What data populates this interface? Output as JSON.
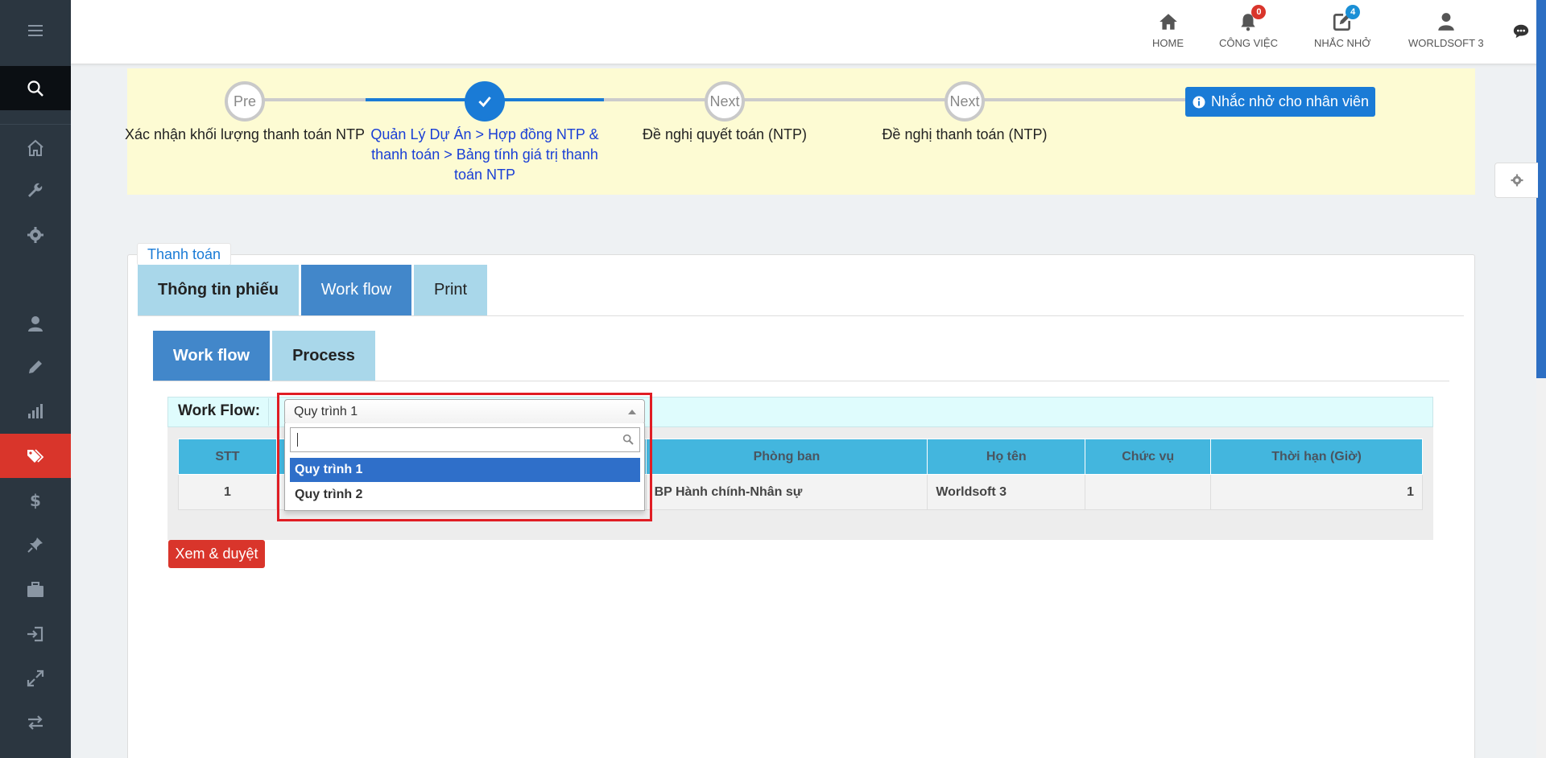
{
  "topbar": {
    "home_label": "HOME",
    "tasks_label": "CÔNG VIỆC",
    "tasks_count": "0",
    "reminders_label": "NHẮC NHỞ",
    "reminders_count": "4",
    "user_label": "WORLDSOFT 3"
  },
  "process": {
    "steps": [
      {
        "circle": "Pre",
        "label": "Xác nhận khối lượng thanh toán NTP"
      },
      {
        "circle": "",
        "label": "Quản Lý Dự Án > Hợp đồng NTP & thanh toán > Bảng tính giá trị thanh toán NTP"
      },
      {
        "circle": "Next",
        "label": "Đề nghị quyết toán (NTP)"
      },
      {
        "circle": "Next",
        "label": "Đề nghị thanh toán (NTP)"
      }
    ],
    "remind_button": "Nhắc nhở cho nhân viên"
  },
  "panel": {
    "legend": "Thanh toán",
    "tabs": [
      "Thông tin phiếu",
      "Work flow",
      "Print"
    ],
    "subtabs": [
      "Work flow",
      "Process"
    ],
    "workflow_label": "Work Flow:",
    "workflow_selected": "Quy trình 1",
    "workflow_options": [
      "Quy trình 1",
      "Quy trình 2"
    ]
  },
  "table": {
    "headers": [
      "STT",
      "",
      "Phòng ban",
      "Họ tên",
      "Chức vụ",
      "Thời hạn (Giờ)"
    ],
    "rows": [
      [
        "1",
        "",
        "BP Hành chính-Nhân sự",
        "Worldsoft 3",
        "",
        "1"
      ]
    ]
  },
  "approve_button": "Xem & duyệt",
  "colors": {
    "sidebar": "#2b3640",
    "accent_blue": "#1a7bd6",
    "danger": "#d9352b",
    "process_bg": "#fdfbd3",
    "table_header": "#43b6de"
  }
}
